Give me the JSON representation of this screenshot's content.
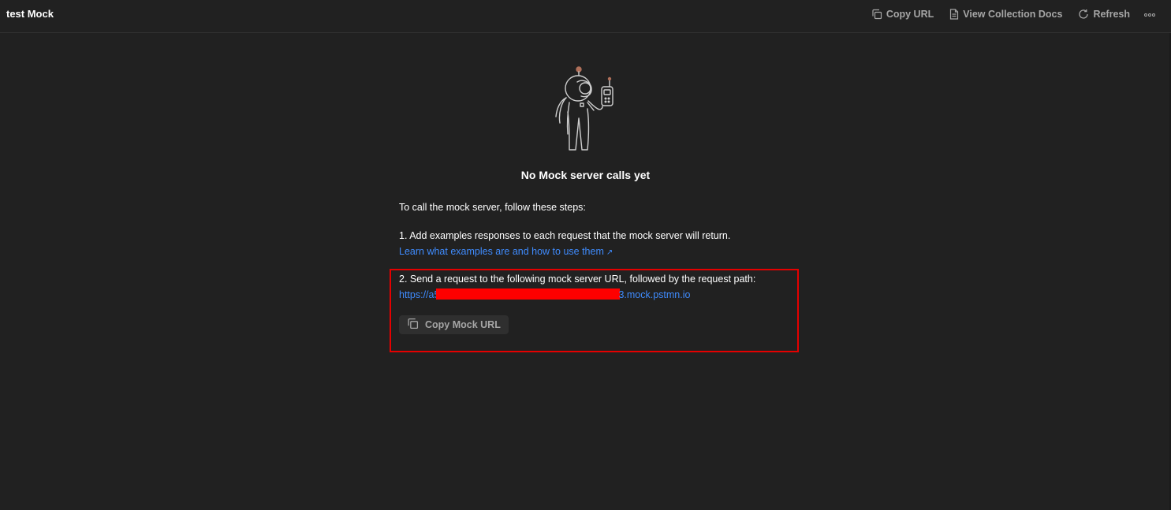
{
  "header": {
    "title": "test Mock",
    "actions": [
      {
        "label": "Copy URL",
        "icon": "copy-icon"
      },
      {
        "label": "View Collection Docs",
        "icon": "document-icon"
      },
      {
        "label": "Refresh",
        "icon": "refresh-icon"
      }
    ],
    "more_icon": "more-horizontal-icon"
  },
  "empty_state": {
    "illustration": "astronaut-with-walkie-talkie",
    "title": "No Mock server calls yet",
    "intro": "To call the mock server, follow these steps:",
    "step1": {
      "text": "1. Add examples responses to each request that the mock server will return.",
      "link": "Learn what examples are and how to use them",
      "link_icon": "↗"
    },
    "step2": {
      "text": "2. Send a request to the following mock server URL, followed by the request path:",
      "url_prefix": "https://a5",
      "url_suffix": "3.mock.pstmn.io",
      "button_label": "Copy Mock URL",
      "button_icon": "copy-icon"
    }
  },
  "colors": {
    "background": "#212121",
    "link": "#3f8bfd",
    "highlight_border": "#e50000",
    "redaction": "#ff0000"
  }
}
